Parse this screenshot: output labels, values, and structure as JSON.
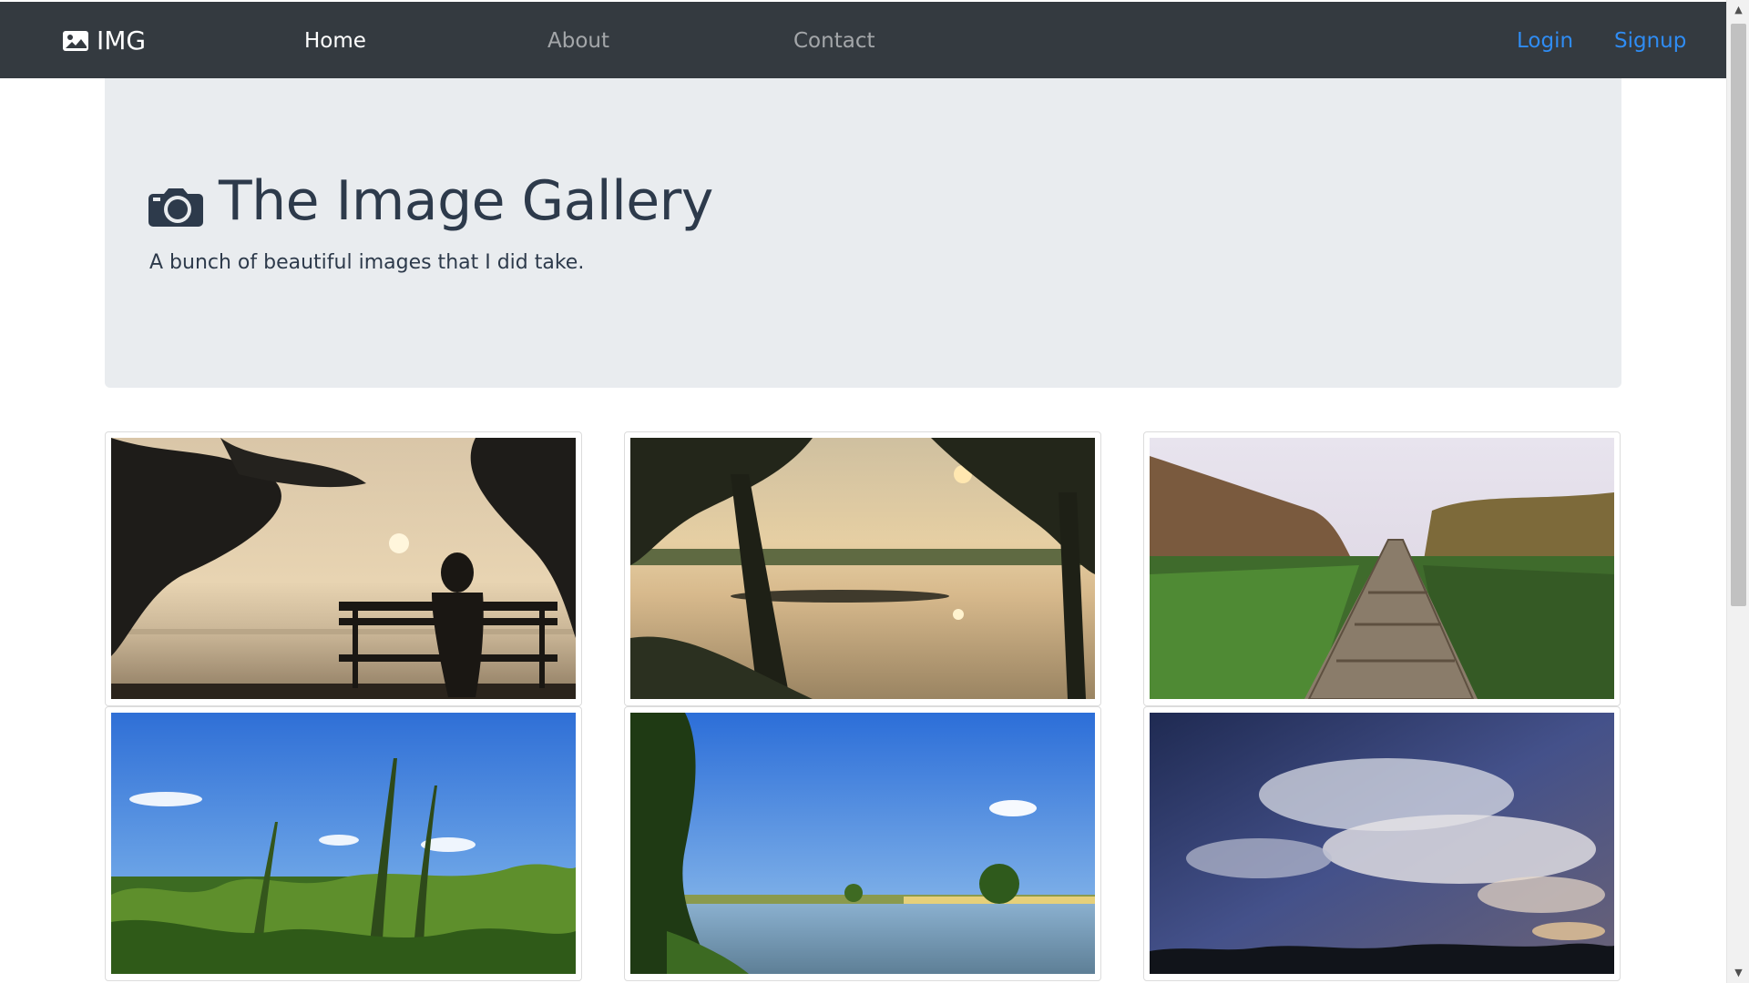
{
  "navbar": {
    "brand": "IMG",
    "links": [
      {
        "label": "Home",
        "active": true
      },
      {
        "label": "About",
        "active": false
      },
      {
        "label": "Contact",
        "active": false
      }
    ],
    "auth": {
      "login": "Login",
      "signup": "Signup"
    },
    "background": "#343a40",
    "link_color": "#2f8cf3"
  },
  "hero": {
    "title": "The Image Gallery",
    "subtitle": "A bunch of beautiful images that I did take.",
    "background": "#e9ecef",
    "text_color": "#2d3a4b"
  },
  "gallery": {
    "images": [
      {
        "name": "photo-bench-sunset-silhouette",
        "scene": "silhouette of person on bench at sunset by lake"
      },
      {
        "name": "photo-lake-sunset-trees",
        "scene": "sunset over lake framed by trees"
      },
      {
        "name": "photo-wooden-boardwalk",
        "scene": "wooden boardwalk through green marsh"
      },
      {
        "name": "photo-grass-blue-sky",
        "scene": "tall grass against blue sky"
      },
      {
        "name": "photo-lake-blue-sky",
        "scene": "calm lake under blue sky with trees"
      },
      {
        "name": "photo-cloudy-dusk-sky",
        "scene": "dramatic clouds at dusk"
      }
    ]
  }
}
